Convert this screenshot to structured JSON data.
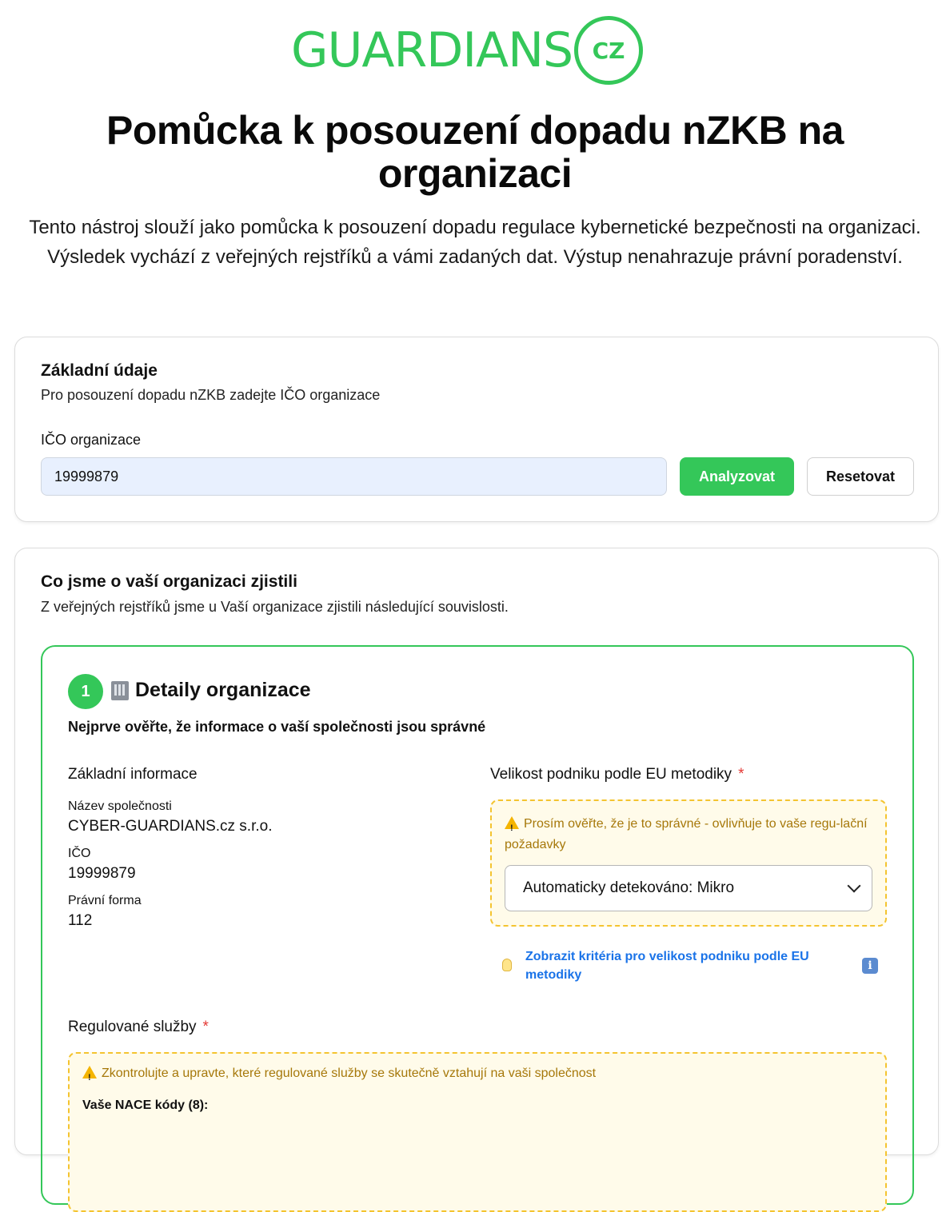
{
  "logo": {
    "text": "GUARDIANS",
    "badge": "CZ",
    "color": "#34c759"
  },
  "header": {
    "title": "Pomůcka k posouzení dopadu nZKB na organizaci",
    "intro": "Tento nástroj slouží jako pomůcka k posouzení dopadu regulace kybernetické bezpečnosti na organizaci. Výsledek vychází z veřejných rejstříků a vámi zadaných dat. Výstup nenahrazuje právní poradenství."
  },
  "basic": {
    "title": "Základní údaje",
    "subtitle": "Pro posouzení dopadu nZKB zadejte IČO organizace",
    "ico_label": "IČO organizace",
    "ico_value": "19999879",
    "analyze_label": "Analyzovat",
    "reset_label": "Resetovat"
  },
  "findings": {
    "title": "Co jsme o vaší organizaci zjistili",
    "subtitle": "Z veřejných rejstříků jsme u Vaší organizace zjistili následující souvislosti.",
    "step": {
      "number": "1",
      "title": "Detaily organizace",
      "description": "Nejprve ověřte, že informace o vaší společnosti jsou správné",
      "basic_info": {
        "heading": "Základní informace",
        "name_label": "Název společnosti",
        "name_value": "CYBER-GUARDIANS.cz s.r.o.",
        "ico_label": "IČO",
        "ico_value": "19999879",
        "form_label": "Právní forma",
        "form_value": "112"
      },
      "size": {
        "heading": "Velikost podniku podle EU metodiky",
        "required": "*",
        "warning": "Prosím ověřte, že je to správné - ovlivňuje to vaše regu-lační požadavky",
        "selected": "Automaticky detekováno: Mikro",
        "criteria_link": "Zobrazit kritéria pro velikost podniku podle EU metodiky",
        "info_icon": "i"
      },
      "services": {
        "heading": "Regulované služby",
        "required": "*",
        "warning": "Zkontrolujte a upravte, které regulované služby se skutečně vztahují na vaši společnost",
        "nace_label": "Vaše NACE kódy (8):"
      }
    }
  },
  "colors": {
    "accent": "#34c759",
    "warning_text": "#a6780a",
    "warning_border": "#f4c430",
    "link": "#1a73e8",
    "required": "#e53935"
  }
}
